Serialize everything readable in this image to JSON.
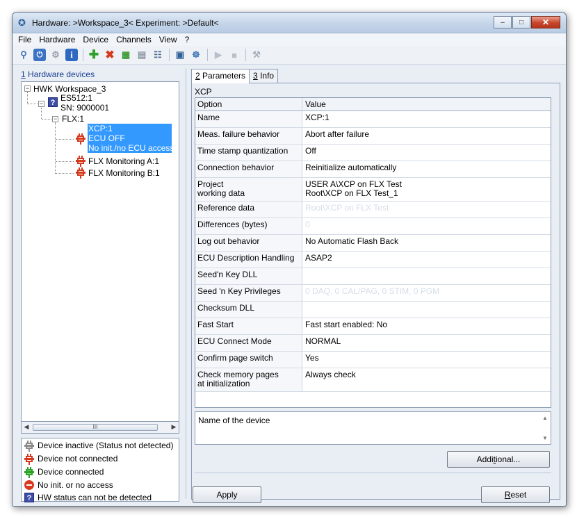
{
  "window": {
    "title": "Hardware: >Workspace_3<   Experiment: >Default<",
    "buttons": {
      "minimize": "‒",
      "maximize": "□",
      "close": "✕"
    }
  },
  "menu": [
    "File",
    "Hardware",
    "Device",
    "Channels",
    "View",
    "?"
  ],
  "toolbar": {
    "icons": [
      "search-icon",
      "power-icon",
      "plug-icon",
      "info-icon",
      "add-icon",
      "delete-icon",
      "module-icon",
      "device-icon",
      "network-icon",
      "monitor-icon",
      "settings-icon",
      "play-icon",
      "stop-icon",
      "tools-icon"
    ]
  },
  "left": {
    "header_num": "1",
    "header_text": " Hardware devices",
    "tree": {
      "workspace": "HWK Workspace_3",
      "es_line1": "ES512:1",
      "es_line2": "SN: 9000001",
      "flx": "FLX:1",
      "xcp_line1": "XCP:1",
      "xcp_line2": "ECU OFF",
      "xcp_line3": "No init./no ECU access",
      "mon_a": "FLX Monitoring A:1",
      "mon_b": "FLX Monitoring B:1"
    },
    "scroll_grip": "III",
    "legend": [
      "Device inactive (Status not detected)",
      "Device not connected",
      "Device connected",
      "No init. or no access",
      "HW status can not be detected"
    ]
  },
  "right": {
    "tabs": [
      {
        "num": "2",
        "label": " Parameters"
      },
      {
        "num": "3",
        "label": " Info"
      }
    ],
    "section": "XCP",
    "columns": {
      "option": "Option",
      "value": "Value"
    },
    "rows": [
      {
        "option": "Name",
        "value": "XCP:1"
      },
      {
        "option": "Meas. failure behavior",
        "value": "Abort after failure"
      },
      {
        "option": "Time stamp quantization",
        "value": "Off"
      },
      {
        "option": "Connection behavior",
        "value": "Reinitialize automatically"
      },
      {
        "option": "Project\nworking data",
        "value": "USER A\\XCP on FLX Test\nRoot\\XCP on FLX Test_1"
      },
      {
        "option": "Reference data",
        "value": "Root\\XCP on FLX Test"
      },
      {
        "option": "Differences (bytes)",
        "value": "0"
      },
      {
        "option": "Log out behavior",
        "value": "No Automatic Flash Back"
      },
      {
        "option": "ECU Description Handling",
        "value": "ASAP2"
      },
      {
        "option": "Seed'n Key DLL",
        "value": ""
      },
      {
        "option": "Seed 'n Key Privileges",
        "value": "0 DAQ, 0 CAL/PAG, 0 STIM, 0 PGM"
      },
      {
        "option": "Checksum DLL",
        "value": ""
      },
      {
        "option": "Fast Start",
        "value": "Fast start enabled: No"
      },
      {
        "option": "ECU Connect Mode",
        "value": "NORMAL"
      },
      {
        "option": "Confirm page switch",
        "value": "Yes"
      },
      {
        "option": "Check memory pages\nat initialization",
        "value": "Always check"
      }
    ],
    "description": "Name of the device",
    "additional_pre": "Addi",
    "additional_u": "t",
    "additional_post": "ional...",
    "apply": "Apply",
    "reset_u": "R",
    "reset_post": "eset"
  }
}
